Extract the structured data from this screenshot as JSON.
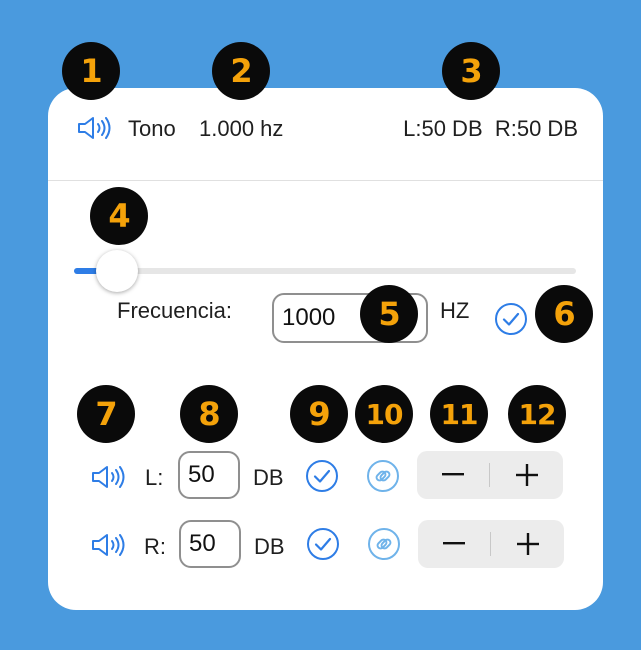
{
  "header": {
    "tone_label": "Tono",
    "frequency_value": "1.000 hz",
    "levels_value": "L:50 DB  R:50 DB"
  },
  "frequency": {
    "label": "Frecuencia:",
    "input_value": "1000",
    "unit": "HZ",
    "slider_level_fraction": 0.04
  },
  "left_channel": {
    "label": "L:",
    "db_value": "50",
    "unit": "DB"
  },
  "right_channel": {
    "label": "R:",
    "db_value": "50",
    "unit": "DB"
  },
  "badges": [
    "1",
    "2",
    "3",
    "4",
    "5",
    "6",
    "7",
    "8",
    "9",
    "10",
    "11",
    "12"
  ],
  "colors": {
    "background": "#4a9ade",
    "accent": "#2e7de6",
    "badge_bg": "#0a0a0a",
    "badge_text": "#f4a20a"
  }
}
